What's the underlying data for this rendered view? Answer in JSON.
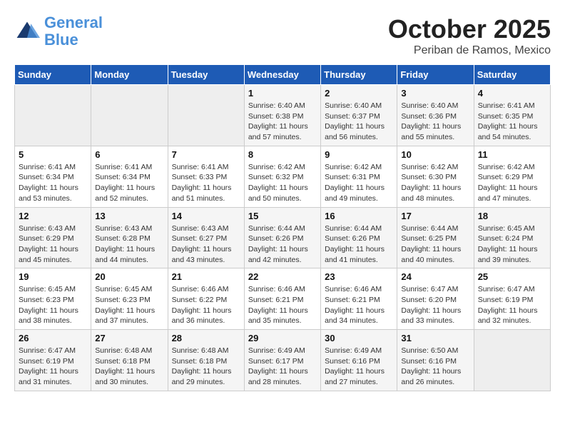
{
  "logo": {
    "line1": "General",
    "line2": "Blue"
  },
  "title": "October 2025",
  "subtitle": "Periban de Ramos, Mexico",
  "weekdays": [
    "Sunday",
    "Monday",
    "Tuesday",
    "Wednesday",
    "Thursday",
    "Friday",
    "Saturday"
  ],
  "weeks": [
    [
      {
        "day": "",
        "sunrise": "",
        "sunset": "",
        "daylight": ""
      },
      {
        "day": "",
        "sunrise": "",
        "sunset": "",
        "daylight": ""
      },
      {
        "day": "",
        "sunrise": "",
        "sunset": "",
        "daylight": ""
      },
      {
        "day": "1",
        "sunrise": "Sunrise: 6:40 AM",
        "sunset": "Sunset: 6:38 PM",
        "daylight": "Daylight: 11 hours and 57 minutes."
      },
      {
        "day": "2",
        "sunrise": "Sunrise: 6:40 AM",
        "sunset": "Sunset: 6:37 PM",
        "daylight": "Daylight: 11 hours and 56 minutes."
      },
      {
        "day": "3",
        "sunrise": "Sunrise: 6:40 AM",
        "sunset": "Sunset: 6:36 PM",
        "daylight": "Daylight: 11 hours and 55 minutes."
      },
      {
        "day": "4",
        "sunrise": "Sunrise: 6:41 AM",
        "sunset": "Sunset: 6:35 PM",
        "daylight": "Daylight: 11 hours and 54 minutes."
      }
    ],
    [
      {
        "day": "5",
        "sunrise": "Sunrise: 6:41 AM",
        "sunset": "Sunset: 6:34 PM",
        "daylight": "Daylight: 11 hours and 53 minutes."
      },
      {
        "day": "6",
        "sunrise": "Sunrise: 6:41 AM",
        "sunset": "Sunset: 6:34 PM",
        "daylight": "Daylight: 11 hours and 52 minutes."
      },
      {
        "day": "7",
        "sunrise": "Sunrise: 6:41 AM",
        "sunset": "Sunset: 6:33 PM",
        "daylight": "Daylight: 11 hours and 51 minutes."
      },
      {
        "day": "8",
        "sunrise": "Sunrise: 6:42 AM",
        "sunset": "Sunset: 6:32 PM",
        "daylight": "Daylight: 11 hours and 50 minutes."
      },
      {
        "day": "9",
        "sunrise": "Sunrise: 6:42 AM",
        "sunset": "Sunset: 6:31 PM",
        "daylight": "Daylight: 11 hours and 49 minutes."
      },
      {
        "day": "10",
        "sunrise": "Sunrise: 6:42 AM",
        "sunset": "Sunset: 6:30 PM",
        "daylight": "Daylight: 11 hours and 48 minutes."
      },
      {
        "day": "11",
        "sunrise": "Sunrise: 6:42 AM",
        "sunset": "Sunset: 6:29 PM",
        "daylight": "Daylight: 11 hours and 47 minutes."
      }
    ],
    [
      {
        "day": "12",
        "sunrise": "Sunrise: 6:43 AM",
        "sunset": "Sunset: 6:29 PM",
        "daylight": "Daylight: 11 hours and 45 minutes."
      },
      {
        "day": "13",
        "sunrise": "Sunrise: 6:43 AM",
        "sunset": "Sunset: 6:28 PM",
        "daylight": "Daylight: 11 hours and 44 minutes."
      },
      {
        "day": "14",
        "sunrise": "Sunrise: 6:43 AM",
        "sunset": "Sunset: 6:27 PM",
        "daylight": "Daylight: 11 hours and 43 minutes."
      },
      {
        "day": "15",
        "sunrise": "Sunrise: 6:44 AM",
        "sunset": "Sunset: 6:26 PM",
        "daylight": "Daylight: 11 hours and 42 minutes."
      },
      {
        "day": "16",
        "sunrise": "Sunrise: 6:44 AM",
        "sunset": "Sunset: 6:26 PM",
        "daylight": "Daylight: 11 hours and 41 minutes."
      },
      {
        "day": "17",
        "sunrise": "Sunrise: 6:44 AM",
        "sunset": "Sunset: 6:25 PM",
        "daylight": "Daylight: 11 hours and 40 minutes."
      },
      {
        "day": "18",
        "sunrise": "Sunrise: 6:45 AM",
        "sunset": "Sunset: 6:24 PM",
        "daylight": "Daylight: 11 hours and 39 minutes."
      }
    ],
    [
      {
        "day": "19",
        "sunrise": "Sunrise: 6:45 AM",
        "sunset": "Sunset: 6:23 PM",
        "daylight": "Daylight: 11 hours and 38 minutes."
      },
      {
        "day": "20",
        "sunrise": "Sunrise: 6:45 AM",
        "sunset": "Sunset: 6:23 PM",
        "daylight": "Daylight: 11 hours and 37 minutes."
      },
      {
        "day": "21",
        "sunrise": "Sunrise: 6:46 AM",
        "sunset": "Sunset: 6:22 PM",
        "daylight": "Daylight: 11 hours and 36 minutes."
      },
      {
        "day": "22",
        "sunrise": "Sunrise: 6:46 AM",
        "sunset": "Sunset: 6:21 PM",
        "daylight": "Daylight: 11 hours and 35 minutes."
      },
      {
        "day": "23",
        "sunrise": "Sunrise: 6:46 AM",
        "sunset": "Sunset: 6:21 PM",
        "daylight": "Daylight: 11 hours and 34 minutes."
      },
      {
        "day": "24",
        "sunrise": "Sunrise: 6:47 AM",
        "sunset": "Sunset: 6:20 PM",
        "daylight": "Daylight: 11 hours and 33 minutes."
      },
      {
        "day": "25",
        "sunrise": "Sunrise: 6:47 AM",
        "sunset": "Sunset: 6:19 PM",
        "daylight": "Daylight: 11 hours and 32 minutes."
      }
    ],
    [
      {
        "day": "26",
        "sunrise": "Sunrise: 6:47 AM",
        "sunset": "Sunset: 6:19 PM",
        "daylight": "Daylight: 11 hours and 31 minutes."
      },
      {
        "day": "27",
        "sunrise": "Sunrise: 6:48 AM",
        "sunset": "Sunset: 6:18 PM",
        "daylight": "Daylight: 11 hours and 30 minutes."
      },
      {
        "day": "28",
        "sunrise": "Sunrise: 6:48 AM",
        "sunset": "Sunset: 6:18 PM",
        "daylight": "Daylight: 11 hours and 29 minutes."
      },
      {
        "day": "29",
        "sunrise": "Sunrise: 6:49 AM",
        "sunset": "Sunset: 6:17 PM",
        "daylight": "Daylight: 11 hours and 28 minutes."
      },
      {
        "day": "30",
        "sunrise": "Sunrise: 6:49 AM",
        "sunset": "Sunset: 6:16 PM",
        "daylight": "Daylight: 11 hours and 27 minutes."
      },
      {
        "day": "31",
        "sunrise": "Sunrise: 6:50 AM",
        "sunset": "Sunset: 6:16 PM",
        "daylight": "Daylight: 11 hours and 26 minutes."
      },
      {
        "day": "",
        "sunrise": "",
        "sunset": "",
        "daylight": ""
      }
    ]
  ]
}
